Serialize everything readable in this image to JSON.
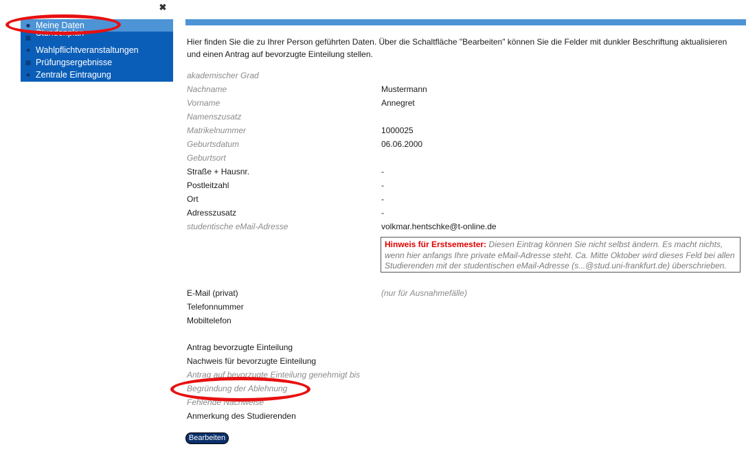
{
  "sidebar": {
    "items": [
      {
        "label": "Meine Daten",
        "icon": "person-icon"
      },
      {
        "label": "Stundenplan",
        "icon": "calendar-icon"
      },
      {
        "label": "Wahlpflichtveranstaltungen",
        "icon": "star-icon"
      },
      {
        "label": "Prüfungsergebnisse",
        "icon": "grid-icon"
      },
      {
        "label": "Zentrale Eintragung",
        "icon": "star-icon"
      }
    ],
    "active": "Meine Daten"
  },
  "intro_text": "Hier finden Sie die zu Ihrer Person geführten Daten. Über die Schaltfläche \"Bearbeiten\" können Sie die Felder mit dunkler Beschriftung aktualisieren und einen Antrag auf bevorzugte Einteilung stellen.",
  "fields": [
    {
      "label": "akademischer Grad",
      "value": ""
    },
    {
      "label": "Nachname",
      "value": "Mustermann"
    },
    {
      "label": "Vorname",
      "value": "Annegret"
    },
    {
      "label": "Namenszusatz",
      "value": ""
    },
    {
      "label": "Matrikelnummer",
      "value": "1000025"
    },
    {
      "label": "Geburtsdatum",
      "value": "06.06.2000"
    },
    {
      "label": "Geburtsort",
      "value": ""
    },
    {
      "label": "Straße + Hausnr.",
      "value": "-"
    },
    {
      "label": "Postleitzahl",
      "value": "-"
    },
    {
      "label": "Ort",
      "value": "-"
    },
    {
      "label": "Adresszusatz",
      "value": "-"
    },
    {
      "label": "studentische eMail-Adresse",
      "value": "volkmar.hentschke@t-online.de"
    }
  ],
  "hint": {
    "title": "Hinweis für Erstsemester:",
    "text": " Diesen Eintrag können Sie nicht selbst ändern. Es macht nichts, wenn hier anfangs Ihre private eMail-Adresse steht. Ca. Mitte Oktober wird dieses Feld bei allen Studierenden mit der studentischen eMail-Adresse (s...@stud.uni-frankfurt.de) überschrieben."
  },
  "contact_fields": [
    {
      "label": "E-Mail (privat)",
      "value": "(nur für Ausnahmefälle)"
    },
    {
      "label": "Telefonnummer",
      "value": ""
    },
    {
      "label": "Mobiltelefon",
      "value": ""
    }
  ],
  "application_fields": [
    {
      "label": "Antrag bevorzugte Einteilung"
    },
    {
      "label": "Nachweis für bevorzugte Einteilung"
    },
    {
      "label": "Antrag auf bevorzugte Einteilung genehmigt bis"
    },
    {
      "label": "Begründung der Ablehnung"
    },
    {
      "label": "Fehlende Nachweise"
    },
    {
      "label": "Anmerkung des Studierenden"
    }
  ],
  "buttons": {
    "edit": "Bearbeiten"
  },
  "colors": {
    "sidebar_bg": "#0b5eb8",
    "active_item": "#4d94d6",
    "highlight_ring": "#e81010",
    "hint_title": "#e00000"
  }
}
